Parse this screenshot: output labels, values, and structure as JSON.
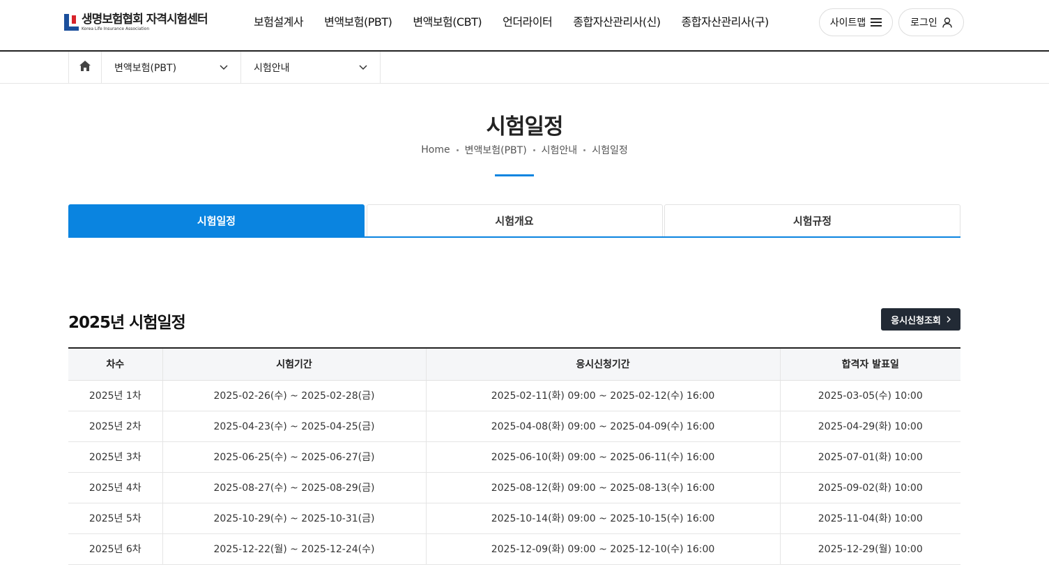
{
  "header": {
    "logo_title": "생명보험협회 자격시험센터",
    "logo_sub": "Korea Life Insurance Association",
    "nav": [
      "보험설계사",
      "변액보험(PBT)",
      "변액보험(CBT)",
      "언더라이터",
      "종합자산관리사(신)",
      "종합자산관리사(구)"
    ],
    "sitemap_label": "사이트맵",
    "login_label": "로그인"
  },
  "location": {
    "menu1": "변액보험(PBT)",
    "menu2": "시험안내"
  },
  "page": {
    "title": "시험일정",
    "breadcrumb": [
      "Home",
      "변액보험(PBT)",
      "시험안내",
      "시험일정"
    ]
  },
  "tabs": [
    "시험일정",
    "시험개요",
    "시험규정"
  ],
  "section": {
    "title": "2025년 시험일정",
    "apply_button": "응시신청조회"
  },
  "table": {
    "headers": [
      "차수",
      "시험기간",
      "응시신청기간",
      "합격자 발표일"
    ],
    "rows": [
      [
        "2025년 1차",
        "2025-02-26(수) ~ 2025-02-28(금)",
        "2025-02-11(화) 09:00 ~ 2025-02-12(수) 16:00",
        "2025-03-05(수) 10:00"
      ],
      [
        "2025년 2차",
        "2025-04-23(수) ~ 2025-04-25(금)",
        "2025-04-08(화) 09:00 ~ 2025-04-09(수) 16:00",
        "2025-04-29(화) 10:00"
      ],
      [
        "2025년 3차",
        "2025-06-25(수) ~ 2025-06-27(금)",
        "2025-06-10(화) 09:00 ~ 2025-06-11(수) 16:00",
        "2025-07-01(화) 10:00"
      ],
      [
        "2025년 4차",
        "2025-08-27(수) ~ 2025-08-29(금)",
        "2025-08-12(화) 09:00 ~ 2025-08-13(수) 16:00",
        "2025-09-02(화) 10:00"
      ],
      [
        "2025년 5차",
        "2025-10-29(수) ~ 2025-10-31(금)",
        "2025-10-14(화) 09:00 ~ 2025-10-15(수) 16:00",
        "2025-11-04(화) 10:00"
      ],
      [
        "2025년 6차",
        "2025-12-22(월) ~ 2025-12-24(수)",
        "2025-12-09(화) 09:00 ~ 2025-12-10(수) 16:00",
        "2025-12-29(월) 10:00"
      ]
    ]
  },
  "colors": {
    "accent": "#0a84e0",
    "dark_button": "#222a35",
    "logo_blue": "#1b4f9c",
    "logo_red": "#d8232a"
  },
  "icons": {
    "sitemap": "hamburger-icon",
    "login": "person-icon",
    "home": "home-icon",
    "select": "chevron-down-icon",
    "apply": "chevron-right-icon"
  }
}
